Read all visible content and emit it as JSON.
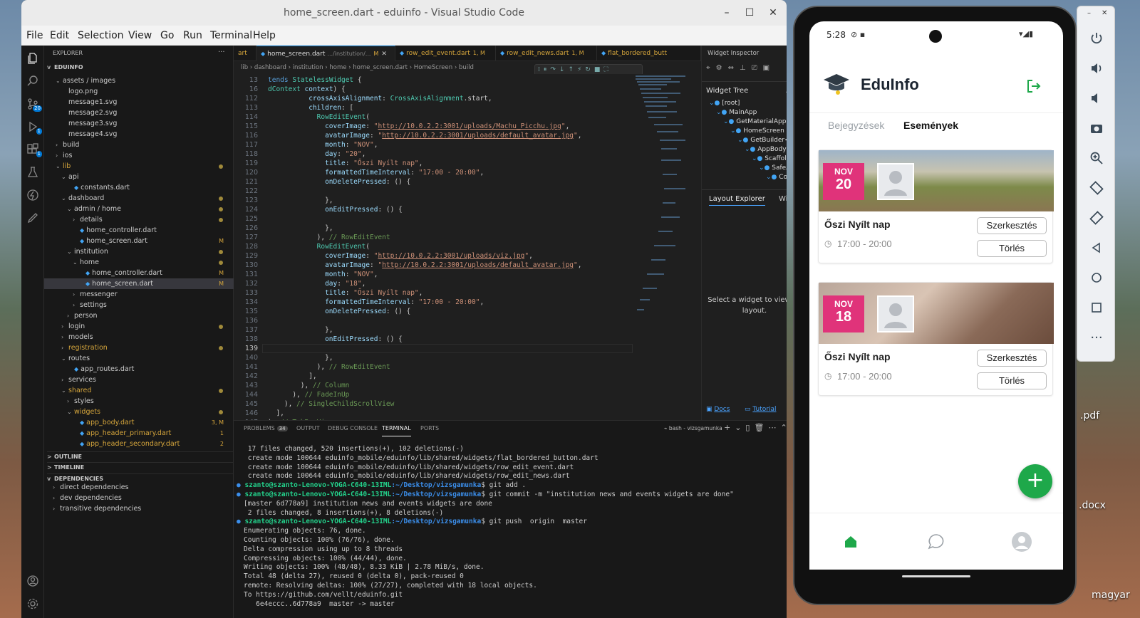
{
  "window": {
    "title": "home_screen.dart - eduinfo - Visual Studio Code",
    "min": "–",
    "max": "☐",
    "close": "✕"
  },
  "menu": [
    "File",
    "Edit",
    "Selection",
    "View",
    "Go",
    "Run",
    "Terminal",
    "Help"
  ],
  "activity": {
    "scm_badge": "20",
    "run_badge": "1",
    "ext_badge": "1"
  },
  "explorer": {
    "header": "EXPLORER",
    "more": "···",
    "root": "EDUINFO",
    "rows": [
      {
        "d": 1,
        "c": "v",
        "t": "assets / images"
      },
      {
        "d": 2,
        "t": "logo.png"
      },
      {
        "d": 2,
        "t": "message1.svg"
      },
      {
        "d": 2,
        "t": "message2.svg"
      },
      {
        "d": 2,
        "t": "message3.svg"
      },
      {
        "d": 2,
        "t": "message4.svg"
      },
      {
        "d": 1,
        "c": ">",
        "t": "build"
      },
      {
        "d": 1,
        "c": ">",
        "t": "ios"
      },
      {
        "d": 1,
        "c": "v",
        "t": "lib",
        "dot": true,
        "y": true
      },
      {
        "d": 2,
        "c": "v",
        "t": "api"
      },
      {
        "d": 3,
        "t": "constants.dart",
        "dart": true
      },
      {
        "d": 2,
        "c": "v",
        "t": "dashboard",
        "dot": true
      },
      {
        "d": 3,
        "c": "v",
        "t": "admin / home",
        "dot": true
      },
      {
        "d": 4,
        "c": ">",
        "t": "details",
        "dot": true
      },
      {
        "d": 4,
        "t": "home_controller.dart",
        "dart": true
      },
      {
        "d": 4,
        "t": "home_screen.dart",
        "dart": true,
        "m": "M"
      },
      {
        "d": 3,
        "c": "v",
        "t": "institution",
        "dot": true
      },
      {
        "d": 4,
        "c": "v",
        "t": "home",
        "dot": true
      },
      {
        "d": 5,
        "t": "home_controller.dart",
        "dart": true,
        "m": "M"
      },
      {
        "d": 5,
        "t": "home_screen.dart",
        "dart": true,
        "m": "M",
        "sel": true
      },
      {
        "d": 4,
        "c": ">",
        "t": "messenger"
      },
      {
        "d": 4,
        "c": ">",
        "t": "settings"
      },
      {
        "d": 3,
        "c": ">",
        "t": "person"
      },
      {
        "d": 2,
        "c": ">",
        "t": "login",
        "dot": true
      },
      {
        "d": 2,
        "c": ">",
        "t": "models"
      },
      {
        "d": 2,
        "c": ">",
        "t": "registration",
        "dot": true,
        "y": true
      },
      {
        "d": 2,
        "c": "v",
        "t": "routes"
      },
      {
        "d": 3,
        "t": "app_routes.dart",
        "dart": true
      },
      {
        "d": 2,
        "c": ">",
        "t": "services"
      },
      {
        "d": 2,
        "c": "v",
        "t": "shared",
        "dot": true,
        "y": true
      },
      {
        "d": 3,
        "c": ">",
        "t": "styles"
      },
      {
        "d": 3,
        "c": "v",
        "t": "widgets",
        "dot": true,
        "y": true
      },
      {
        "d": 4,
        "t": "app_body.dart",
        "dart": true,
        "m": "3, M",
        "y": true
      },
      {
        "d": 4,
        "t": "app_header_primary.dart",
        "dart": true,
        "m": "1",
        "y": true
      },
      {
        "d": 4,
        "t": "app_header_secondary.dart",
        "dart": true,
        "m": "2",
        "y": true
      }
    ],
    "outline": "OUTLINE",
    "timeline": "TIMELINE",
    "dependencies": "DEPENDENCIES",
    "deps": [
      "direct dependencies",
      "dev dependencies",
      "transitive dependencies"
    ]
  },
  "tabs": [
    {
      "t": "art"
    },
    {
      "t": "home_screen.dart",
      "sub": ".../institution/...",
      "m": "M",
      "active": true
    },
    {
      "t": "row_edit_event.dart",
      "m": "1, M"
    },
    {
      "t": "row_edit_news.dart",
      "m": "1, M"
    },
    {
      "t": "flat_bordered_butt"
    }
  ],
  "breadcrumb": "lib › dashboard › institution › home › home_screen.dart › HomeScreen › build",
  "code": [
    {
      "n": "13",
      "h": "<span class='k'>tends</span> <span class='t'>StatelessWidget</span> {"
    },
    {
      "n": "16",
      "h": "<span class='t'>dContext</span> <span class='p'>context</span>) {"
    },
    {
      "n": "112",
      "h": "          <span class='p'>crossAxisAlignment</span>: <span class='t'>CrossAxisAlignment</span>.start,"
    },
    {
      "n": "113",
      "h": "          <span class='p'>children</span>: ["
    },
    {
      "n": "114",
      "h": "            <span class='t'>RowEditEvent</span>("
    },
    {
      "n": "115",
      "h": "              <span class='p'>coverImage</span>: <span class='s'>\"<span class='u'>http://10.0.2.2:3001/uploads/Machu_Picchu.jpg</span>\"</span>,"
    },
    {
      "n": "116",
      "h": "              <span class='p'>avatarImage</span>: <span class='s'>\"<span class='u'>http://10.0.2.2:3001/uploads/default_avatar.jpg</span>\"</span>,"
    },
    {
      "n": "117",
      "h": "              <span class='p'>month</span>: <span class='s'>\"NOV\"</span>,"
    },
    {
      "n": "118",
      "h": "              <span class='p'>day</span>: <span class='s'>\"20\"</span>,"
    },
    {
      "n": "119",
      "h": "              <span class='p'>title</span>: <span class='s'>\"Őszi Nyílt nap\"</span>,"
    },
    {
      "n": "120",
      "h": "              <span class='p'>formattedTimeInterval</span>: <span class='s'>\"17:00 - 20:00\"</span>,"
    },
    {
      "n": "121",
      "h": "              <span class='p'>onDeletePressed</span>: () {"
    },
    {
      "n": "122",
      "h": ""
    },
    {
      "n": "123",
      "h": "              },"
    },
    {
      "n": "124",
      "h": "              <span class='p'>onEditPressed</span>: () {"
    },
    {
      "n": "125",
      "h": ""
    },
    {
      "n": "126",
      "h": "              },"
    },
    {
      "n": "127",
      "h": "            ), <span class='c'>// RowEditEvent</span>"
    },
    {
      "n": "128",
      "h": "            <span class='t'>RowEditEvent</span>("
    },
    {
      "n": "129",
      "h": "              <span class='p'>coverImage</span>: <span class='s'>\"<span class='u'>http://10.0.2.2:3001/uploads/viz.jpg</span>\"</span>,"
    },
    {
      "n": "130",
      "h": "              <span class='p'>avatarImage</span>: <span class='s'>\"<span class='u'>http://10.0.2.2:3001/uploads/default_avatar.jpg</span>\"</span>,"
    },
    {
      "n": "131",
      "h": "              <span class='p'>month</span>: <span class='s'>\"NOV\"</span>,"
    },
    {
      "n": "132",
      "h": "              <span class='p'>day</span>: <span class='s'>\"18\"</span>,"
    },
    {
      "n": "133",
      "h": "              <span class='p'>title</span>: <span class='s'>\"Őszi Nyílt nap\"</span>,"
    },
    {
      "n": "134",
      "h": "              <span class='p'>formattedTimeInterval</span>: <span class='s'>\"17:00 - 20:00\"</span>,"
    },
    {
      "n": "135",
      "h": "              <span class='p'>onDeletePressed</span>: () {"
    },
    {
      "n": "136",
      "h": ""
    },
    {
      "n": "137",
      "h": "              },"
    },
    {
      "n": "138",
      "h": "              <span class='p'>onEditPressed</span>: () {"
    },
    {
      "n": "139",
      "h": "",
      "cur": true
    },
    {
      "n": "140",
      "h": "              },"
    },
    {
      "n": "141",
      "h": "            ), <span class='c'>// RowEditEvent</span>"
    },
    {
      "n": "142",
      "h": "          ],"
    },
    {
      "n": "143",
      "h": "        ), <span class='c'>// Column</span>"
    },
    {
      "n": "144",
      "h": "      ), <span class='c'>// FadeInUp</span>"
    },
    {
      "n": "145",
      "h": "    ), <span class='c'>// SingleChildScrollView</span>"
    },
    {
      "n": "146",
      "h": "  ],"
    },
    {
      "n": "147",
      "h": "), <span class='c'>// TabBarView</span>"
    }
  ],
  "inspector": {
    "title": "Widget Inspector",
    "tree_label": "Widget Tree",
    "tree": [
      {
        "d": 0,
        "t": "[root]"
      },
      {
        "d": 1,
        "t": "MainApp"
      },
      {
        "d": 2,
        "t": "GetMaterialApp"
      },
      {
        "d": 3,
        "t": "HomeScreen"
      },
      {
        "d": 4,
        "t": "GetBuilder<H..."
      },
      {
        "d": 5,
        "t": "AppBody"
      },
      {
        "d": 6,
        "t": "Scaffold"
      },
      {
        "d": 7,
        "t": "SafeArea"
      },
      {
        "d": 8,
        "t": "Column"
      }
    ],
    "tab_layout": "Layout Explorer",
    "tab_widget": "Widget",
    "empty": "Select a widget to view its layout.",
    "docs": "Docs",
    "tutorial": "Tutorial",
    "more": "xt"
  },
  "panel": {
    "tabs": [
      "PROBLEMS",
      "OUTPUT",
      "DEBUG CONSOLE",
      "TERMINAL",
      "PORTS"
    ],
    "problems_badge": "34",
    "active": "TERMINAL",
    "shell": "bash - vizsgamunka",
    "lines": [
      {
        "t": " 17 files changed, 520 insertions(+), 102 deletions(-)"
      },
      {
        "t": " create mode 100644 eduinfo_mobile/eduinfo/lib/shared/widgets/flat_bordered_button.dart"
      },
      {
        "t": " create mode 100644 eduinfo_mobile/eduinfo/lib/shared/widgets/row_edit_event.dart"
      },
      {
        "t": " create mode 100644 eduinfo_mobile/eduinfo/lib/shared/widgets/row_edit_news.dart"
      },
      {
        "u": "szanto@szanto-Lenovo-YOGA-C640-13IML",
        "p": ":~/Desktop/vizsgamunka",
        "t": "$ git add ."
      },
      {
        "u": "szanto@szanto-Lenovo-YOGA-C640-13IML",
        "p": ":~/Desktop/vizsgamunka",
        "t": "$ git commit -m \"institution news and events widgets are done\""
      },
      {
        "t": "[master 6d778a9] institution news and events widgets are done"
      },
      {
        "t": " 2 files changed, 8 insertions(+), 8 deletions(-)"
      },
      {
        "u": "szanto@szanto-Lenovo-YOGA-C640-13IML",
        "p": ":~/Desktop/vizsgamunka",
        "t": "$ git push  origin  master"
      },
      {
        "t": "Enumerating objects: 76, done."
      },
      {
        "t": "Counting objects: 100% (76/76), done."
      },
      {
        "t": "Delta compression using up to 8 threads"
      },
      {
        "t": "Compressing objects: 100% (44/44), done."
      },
      {
        "t": "Writing objects: 100% (48/48), 8.33 KiB | 2.78 MiB/s, done."
      },
      {
        "t": "Total 48 (delta 27), reused 0 (delta 0), pack-reused 0"
      },
      {
        "t": "remote: Resolving deltas: 100% (27/27), completed with 18 local objects."
      },
      {
        "t": "To https://github.com/vellt/eduinfo.git"
      },
      {
        "t": "   6e4eccc..6d778a9  master -> master"
      }
    ]
  },
  "phone": {
    "time": "5:28",
    "app_title": "EduInfo",
    "tabs": [
      "Bejegyzések",
      "Események"
    ],
    "active_tab": 1,
    "events": [
      {
        "month": "NOV",
        "day": "20",
        "title": "Őszi Nyílt nap",
        "time": "17:00 - 20:00",
        "edit": "Szerkesztés",
        "delete": "Törlés"
      },
      {
        "month": "NOV",
        "day": "18",
        "title": "Őszi Nyílt nap",
        "time": "17:00 - 20:00",
        "edit": "Szerkesztés",
        "delete": "Törlés"
      }
    ],
    "fab": "+",
    "accent": "#1ea84a",
    "date_color": "#e0337a"
  },
  "desktop": {
    "pdf": ".pdf",
    "docx": ".docx",
    "magyar": "magyar"
  }
}
